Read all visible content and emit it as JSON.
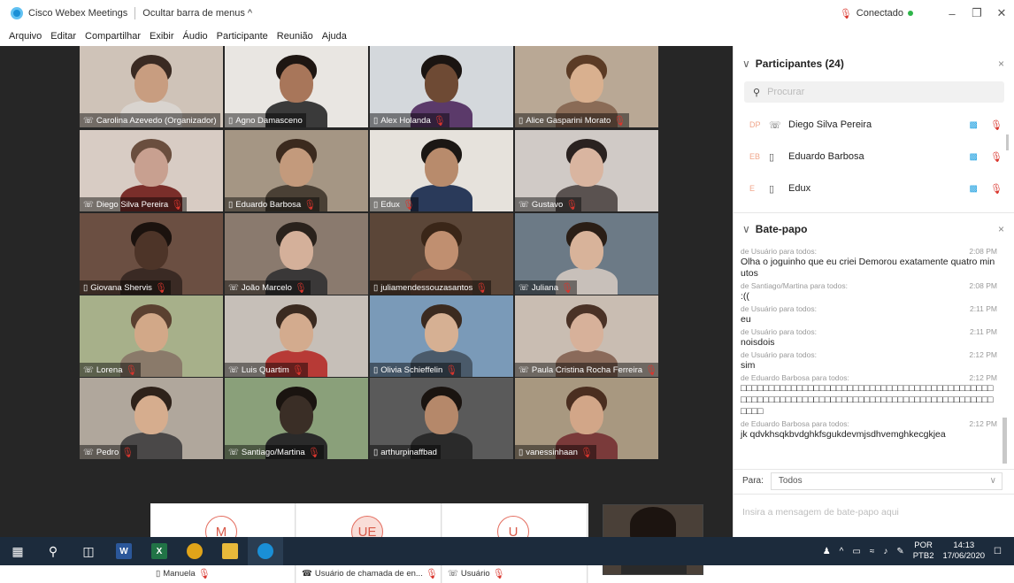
{
  "titlebar": {
    "app_title": "Cisco Webex Meetings",
    "hide_menu_label": "Ocultar barra de menus",
    "hide_menu_chevron": "^",
    "status_label": "Conectado",
    "minimize": "–",
    "restore": "❐",
    "close": "✕"
  },
  "menu": [
    "Arquivo",
    "Editar",
    "Compartilhar",
    "Exibir",
    "Áudio",
    "Participante",
    "Reunião",
    "Ajuda"
  ],
  "video_tiles": [
    {
      "name": "Carolina Azevedo (Organizador)",
      "icon": "phone-icon",
      "muted": false,
      "bg": "#cfc3b8",
      "skin": "#c89d80",
      "shirt": "#d9d4cf",
      "hair": "#3a2a22"
    },
    {
      "name": "Agno Damasceno",
      "icon": "monitor-icon",
      "muted": false,
      "bg": "#e9e6e2",
      "skin": "#a8765a",
      "shirt": "#3a3a3a",
      "hair": "#1e1612"
    },
    {
      "name": "Alex Holanda",
      "icon": "monitor-icon",
      "muted": true,
      "bg": "#d4d8dc",
      "skin": "#6e4a34",
      "shirt": "#5b3a6a",
      "hair": "#1a1411"
    },
    {
      "name": "Alice Gasparini Morato",
      "icon": "monitor-icon",
      "muted": true,
      "bg": "#b9a895",
      "skin": "#d9b08f",
      "shirt": "#8a6b56",
      "hair": "#5b3b25"
    },
    {
      "name": "Diego Silva Pereira",
      "icon": "phone-icon",
      "muted": true,
      "bg": "#d8ccc4",
      "skin": "#c8a090",
      "shirt": "#7a2e2a",
      "hair": "#6a4e3e"
    },
    {
      "name": "Eduardo Barbosa",
      "icon": "monitor-icon",
      "muted": true,
      "bg": "#a59684",
      "skin": "#c39a7c",
      "shirt": "#4a4035",
      "hair": "#3b2a1e"
    },
    {
      "name": "Edux",
      "icon": "monitor-icon",
      "muted": true,
      "bg": "#e6e2dc",
      "skin": "#b88b6c",
      "shirt": "#2a3a5a",
      "hair": "#1b1714"
    },
    {
      "name": "Gustavo",
      "icon": "phone-icon",
      "muted": true,
      "bg": "#d0cac6",
      "skin": "#d9b5a0",
      "shirt": "#5a5250",
      "hair": "#2a2220"
    },
    {
      "name": "Giovana Shervis",
      "icon": "monitor-icon",
      "muted": true,
      "bg": "#6b4f42",
      "skin": "#4d3428",
      "shirt": "#3a2a24",
      "hair": "#1b120e"
    },
    {
      "name": "João Marcelo",
      "icon": "phone-icon",
      "muted": true,
      "bg": "#8a7a6e",
      "skin": "#d4b09a",
      "shirt": "#3a3838",
      "hair": "#2a221c"
    },
    {
      "name": "juliamendessouzasantos",
      "icon": "monitor-icon",
      "muted": true,
      "bg": "#5b4638",
      "skin": "#c08f70",
      "shirt": "#6b4a3a",
      "hair": "#3a2618"
    },
    {
      "name": "Juliana",
      "icon": "phone-icon",
      "muted": true,
      "bg": "#6c7a86",
      "skin": "#d8b39a",
      "shirt": "#c8c0ba",
      "hair": "#2a1e16"
    },
    {
      "name": "Lorena",
      "icon": "phone-icon",
      "muted": true,
      "bg": "#a7b08a",
      "skin": "#d2a888",
      "shirt": "#8a7a6a",
      "hair": "#5a4030"
    },
    {
      "name": "Luis Quartim",
      "icon": "phone-icon",
      "muted": true,
      "bg": "#c6bfb8",
      "skin": "#d3ab8e",
      "shirt": "#b73a36",
      "hair": "#3a2a20"
    },
    {
      "name": "Olivia Schieffelin",
      "icon": "monitor-icon",
      "muted": true,
      "bg": "#7a9ab8",
      "skin": "#d6b093",
      "shirt": "#4a5a6a",
      "hair": "#3b2a1f"
    },
    {
      "name": "Paula Cristina Rocha Ferreira",
      "icon": "phone-icon",
      "muted": true,
      "bg": "#c9bdb2",
      "skin": "#d7b19a",
      "shirt": "#8a6a5a",
      "hair": "#4a3226"
    },
    {
      "name": "Pedro",
      "icon": "phone-icon",
      "muted": true,
      "bg": "#b0a79c",
      "skin": "#d6ad8e",
      "shirt": "#4a4848",
      "hair": "#2e221a"
    },
    {
      "name": "Santiago/Martina",
      "icon": "phone-icon",
      "muted": true,
      "bg": "#8aa07a",
      "skin": "#3a2e26",
      "shirt": "#2a2a2a",
      "hair": "#1a1410"
    },
    {
      "name": "arthurpinaffbad",
      "icon": "monitor-icon",
      "muted": false,
      "bg": "#5a5a5a",
      "skin": "#b5886a",
      "shirt": "#2a2a2a",
      "hair": "#1a1410"
    },
    {
      "name": "vanessinhaan",
      "icon": "monitor-icon",
      "muted": true,
      "bg": "#a89880",
      "skin": "#d2a688",
      "shirt": "#7a3a3a",
      "hair": "#4a2e20"
    }
  ],
  "audio_tiles": [
    {
      "initials": "M",
      "name": "Manuela",
      "icon": "monitor-icon"
    },
    {
      "initials": "UE",
      "name": "Usuário de chamada de en...",
      "icon": "phone-call-icon"
    },
    {
      "initials": "U",
      "name": "Usuário",
      "icon": "phone-icon"
    }
  ],
  "participants_panel": {
    "title": "Participantes (24)",
    "chevron": "∨",
    "close": "×",
    "search_placeholder": "Procurar",
    "items": [
      {
        "initials": "DP",
        "name": "Diego Silva Pereira",
        "icon": "phone-icon"
      },
      {
        "initials": "EB",
        "name": "Eduardo Barbosa",
        "icon": "monitor-icon"
      },
      {
        "initials": "E",
        "name": "Edux",
        "icon": "monitor-icon"
      }
    ]
  },
  "chat_panel": {
    "title": "Bate-papo",
    "chevron": "∨",
    "close": "×",
    "messages": [
      {
        "meta": "de Usuário para todos:",
        "time": "2:08 PM",
        "text": "Olha o joguinho que eu criei Demorou exatamente quatro minutos"
      },
      {
        "meta": "de Santiago/Martina para todos:",
        "time": "2:08 PM",
        "text": ":(("
      },
      {
        "meta": "de Usuário para todos:",
        "time": "2:11 PM",
        "text": "eu"
      },
      {
        "meta": "de Usuário para todos:",
        "time": "2:11 PM",
        "text": "noisdois"
      },
      {
        "meta": "de Usuário para todos:",
        "time": "2:12 PM",
        "text": "sim"
      },
      {
        "meta": "de Eduardo Barbosa para todos:",
        "time": "2:12 PM",
        "text": "□□□□□□□□□□□□□□□□□□□□□□□□□□□□□□□□□□□□□□□□□□□□□□□□□□□□□□□□□□□□□□□□□□□□□□□□□□□□□□□□□□□□□□□□□□□□□□"
      },
      {
        "meta": "de Eduardo Barbosa para todos:",
        "time": "2:12 PM",
        "text": "jk qdvkhsqkbvdghkfsgukdevmjsdhvemghkecgkjea"
      }
    ],
    "to_label": "Para:",
    "to_value": "Todos",
    "input_placeholder": "Insira a mensagem de bate-papo aqui"
  },
  "taskbar": {
    "lang_top": "POR",
    "lang_bottom": "PTB2",
    "time": "14:13",
    "date": "17/06/2020"
  },
  "colors": {
    "accent": "#1c9fe0",
    "muted_red": "#d9352d",
    "connected_green": "#2fb54a",
    "taskbar": "#1c2b3c"
  }
}
